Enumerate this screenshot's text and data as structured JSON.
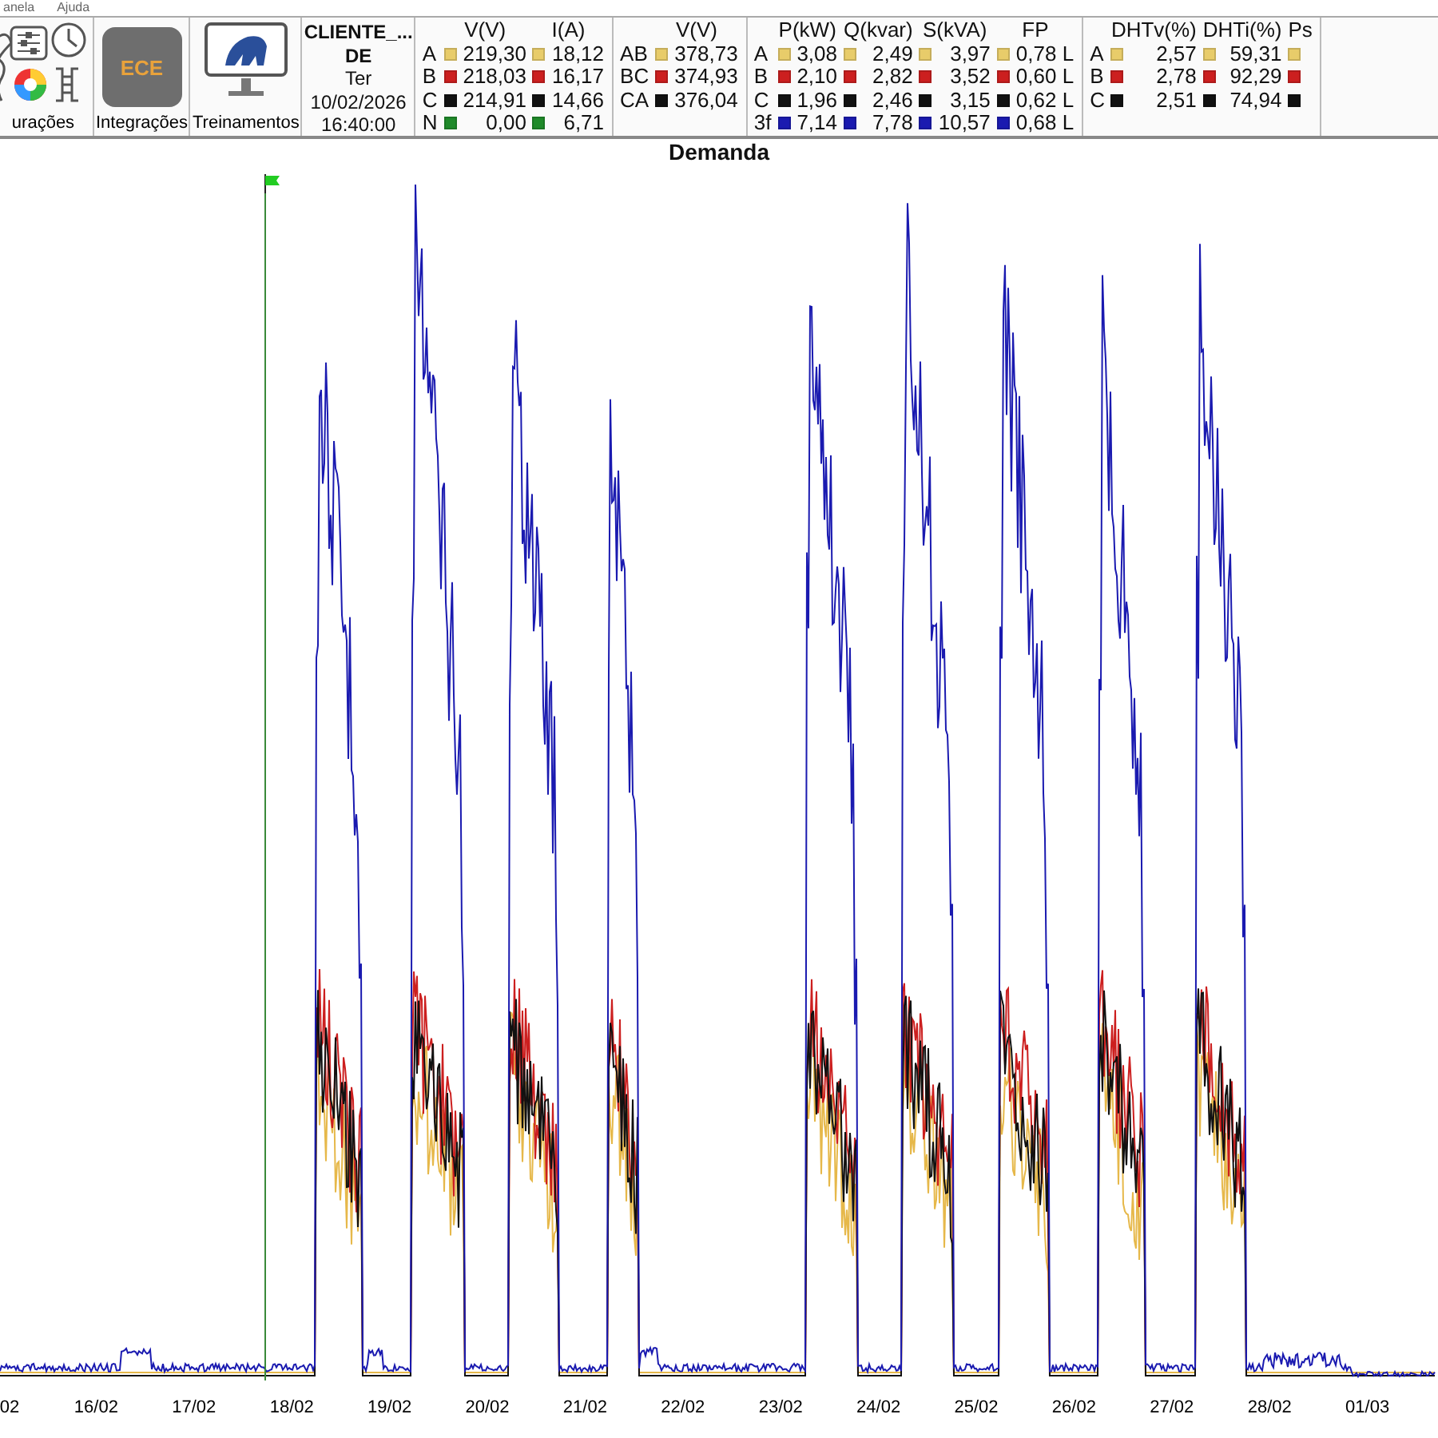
{
  "menu": [
    "anela",
    "Ajuda"
  ],
  "toolbar_buttons": [
    {
      "kind": "settings",
      "label": "urações"
    },
    {
      "kind": "ece",
      "label": "Integrações",
      "logo": "ECE"
    },
    {
      "kind": "monitor",
      "label": "Treinamentos"
    }
  ],
  "client": {
    "name": "CLIENTE_...",
    "line2": "DE",
    "day": "Ter",
    "date": "10/02/2026",
    "time": "16:40:00"
  },
  "panels": [
    {
      "columns": [
        "V(V)",
        "I(A)"
      ],
      "rows": [
        {
          "phase": "A",
          "color": "#e8cc6a",
          "values": [
            "219,30",
            "18,12"
          ]
        },
        {
          "phase": "B",
          "color": "#cc1f1f",
          "values": [
            "218,03",
            "16,17"
          ]
        },
        {
          "phase": "C",
          "color": "#111111",
          "values": [
            "214,91",
            "14,66"
          ]
        },
        {
          "phase": "N",
          "color": "#1f8a2a",
          "values": [
            "0,00",
            "6,71"
          ]
        }
      ]
    },
    {
      "columns": [
        "V(V)"
      ],
      "rows": [
        {
          "phase": "AB",
          "color": "#e8cc6a",
          "values": [
            "378,73"
          ]
        },
        {
          "phase": "BC",
          "color": "#cc1f1f",
          "values": [
            "374,93"
          ]
        },
        {
          "phase": "CA",
          "color": "#111111",
          "values": [
            "376,04"
          ]
        }
      ]
    },
    {
      "columns": [
        "P(kW)",
        "Q(kvar)",
        "S(kVA)",
        "FP"
      ],
      "rows": [
        {
          "phase": "A",
          "color": "#e8cc6a",
          "values": [
            "3,08",
            "2,49",
            "3,97",
            "0,78 L"
          ]
        },
        {
          "phase": "B",
          "color": "#cc1f1f",
          "values": [
            "2,10",
            "2,82",
            "3,52",
            "0,60 L"
          ]
        },
        {
          "phase": "C",
          "color": "#111111",
          "values": [
            "1,96",
            "2,46",
            "3,15",
            "0,62 L"
          ]
        },
        {
          "phase": "3f",
          "color": "#1a1ab0",
          "values": [
            "7,14",
            "7,78",
            "10,57",
            "0,68 L"
          ]
        }
      ]
    },
    {
      "columns": [
        "DHTv(%)",
        "DHTi(%)",
        "Ps"
      ],
      "extra_squares": true,
      "rows": [
        {
          "phase": "A",
          "color": "#e8cc6a",
          "values": [
            "2,57",
            "59,31"
          ]
        },
        {
          "phase": "B",
          "color": "#cc1f1f",
          "values": [
            "2,78",
            "92,29"
          ]
        },
        {
          "phase": "C",
          "color": "#111111",
          "values": [
            "2,51",
            "74,94"
          ]
        }
      ]
    }
  ],
  "chart": {
    "title": "Demanda",
    "x_labels": [
      "02",
      "16/02",
      "17/02",
      "18/02",
      "19/02",
      "20/02",
      "21/02",
      "22/02",
      "23/02",
      "24/02",
      "25/02",
      "26/02",
      "27/02",
      "28/02",
      "01/03"
    ]
  }
}
